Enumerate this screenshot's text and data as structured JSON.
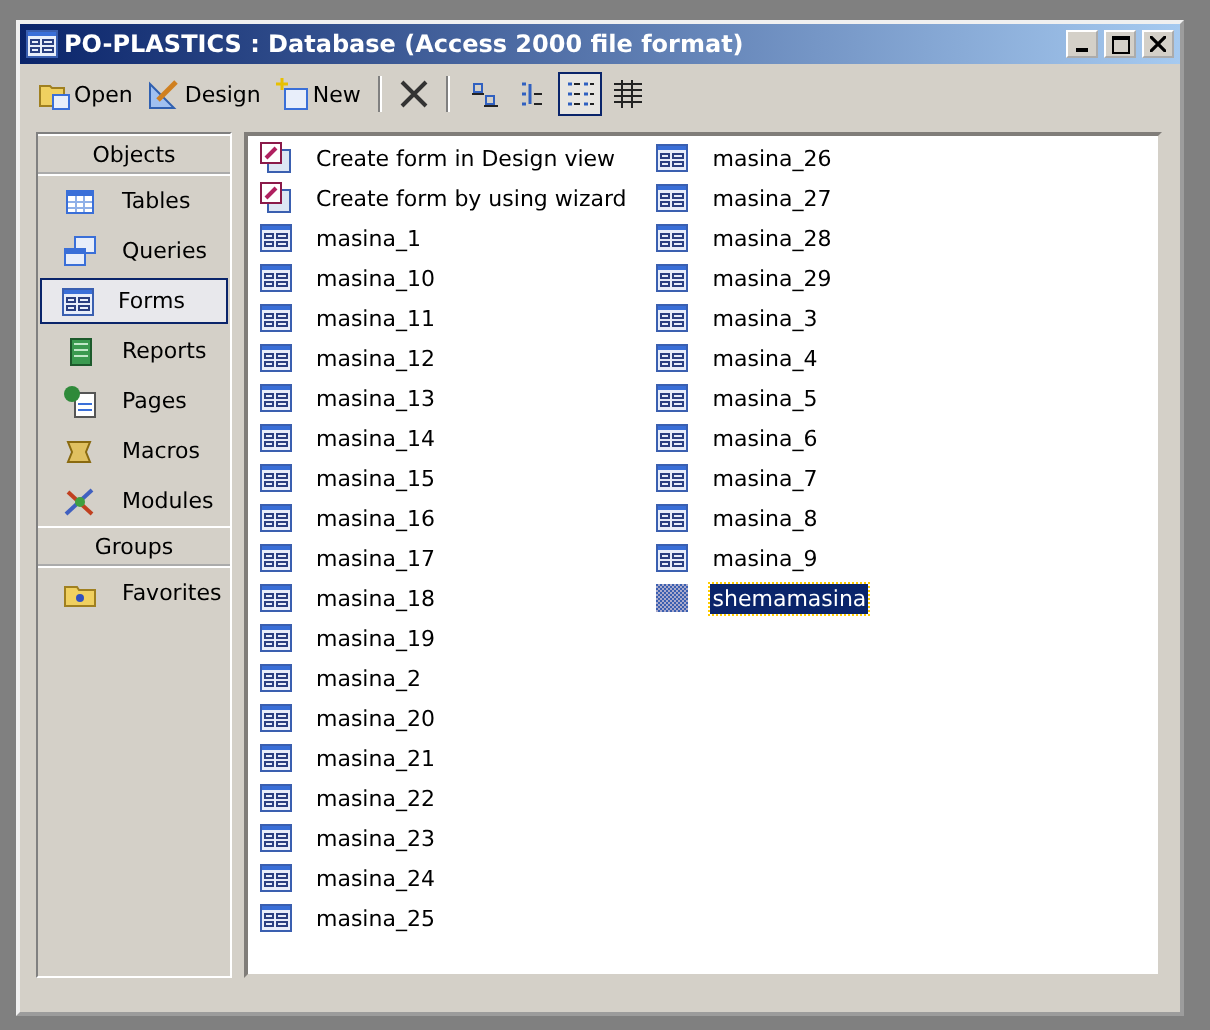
{
  "window": {
    "title": "PO-PLASTICS : Database (Access 2000 file format)"
  },
  "toolbar": {
    "actions": [
      {
        "label": "Open",
        "kind": "open"
      },
      {
        "label": "Design",
        "kind": "design"
      },
      {
        "label": "New",
        "kind": "new"
      }
    ],
    "views": [
      {
        "kind": "large",
        "selected": false
      },
      {
        "kind": "small",
        "selected": false
      },
      {
        "kind": "list",
        "selected": true
      },
      {
        "kind": "details",
        "selected": false
      }
    ]
  },
  "sidebar": {
    "sections": [
      {
        "title": "Objects",
        "items": [
          {
            "label": "Tables",
            "kind": "tables",
            "selected": false
          },
          {
            "label": "Queries",
            "kind": "queries",
            "selected": false
          },
          {
            "label": "Forms",
            "kind": "forms",
            "selected": true
          },
          {
            "label": "Reports",
            "kind": "reports",
            "selected": false
          },
          {
            "label": "Pages",
            "kind": "pages",
            "selected": false
          },
          {
            "label": "Macros",
            "kind": "macros",
            "selected": false
          },
          {
            "label": "Modules",
            "kind": "modules",
            "selected": false
          }
        ]
      },
      {
        "title": "Groups",
        "items": [
          {
            "label": "Favorites",
            "kind": "favorites",
            "selected": false
          }
        ]
      }
    ]
  },
  "list": {
    "items": [
      {
        "label": "Create form in Design view",
        "kind": "shortcut",
        "selected": false
      },
      {
        "label": "Create form by using wizard",
        "kind": "shortcut",
        "selected": false
      },
      {
        "label": "masina_1",
        "kind": "form",
        "selected": false
      },
      {
        "label": "masina_10",
        "kind": "form",
        "selected": false
      },
      {
        "label": "masina_11",
        "kind": "form",
        "selected": false
      },
      {
        "label": "masina_12",
        "kind": "form",
        "selected": false
      },
      {
        "label": "masina_13",
        "kind": "form",
        "selected": false
      },
      {
        "label": "masina_14",
        "kind": "form",
        "selected": false
      },
      {
        "label": "masina_15",
        "kind": "form",
        "selected": false
      },
      {
        "label": "masina_16",
        "kind": "form",
        "selected": false
      },
      {
        "label": "masina_17",
        "kind": "form",
        "selected": false
      },
      {
        "label": "masina_18",
        "kind": "form",
        "selected": false
      },
      {
        "label": "masina_19",
        "kind": "form",
        "selected": false
      },
      {
        "label": "masina_2",
        "kind": "form",
        "selected": false
      },
      {
        "label": "masina_20",
        "kind": "form",
        "selected": false
      },
      {
        "label": "masina_21",
        "kind": "form",
        "selected": false
      },
      {
        "label": "masina_22",
        "kind": "form",
        "selected": false
      },
      {
        "label": "masina_23",
        "kind": "form",
        "selected": false
      },
      {
        "label": "masina_24",
        "kind": "form",
        "selected": false
      },
      {
        "label": "masina_25",
        "kind": "form",
        "selected": false
      },
      {
        "label": "masina_26",
        "kind": "form",
        "selected": false
      },
      {
        "label": "masina_27",
        "kind": "form",
        "selected": false
      },
      {
        "label": "masina_28",
        "kind": "form",
        "selected": false
      },
      {
        "label": "masina_29",
        "kind": "form",
        "selected": false
      },
      {
        "label": "masina_3",
        "kind": "form",
        "selected": false
      },
      {
        "label": "masina_4",
        "kind": "form",
        "selected": false
      },
      {
        "label": "masina_5",
        "kind": "form",
        "selected": false
      },
      {
        "label": "masina_6",
        "kind": "form",
        "selected": false
      },
      {
        "label": "masina_7",
        "kind": "form",
        "selected": false
      },
      {
        "label": "masina_8",
        "kind": "form",
        "selected": false
      },
      {
        "label": "masina_9",
        "kind": "form",
        "selected": false
      },
      {
        "label": "shemamasina",
        "kind": "blank",
        "selected": true
      }
    ]
  }
}
